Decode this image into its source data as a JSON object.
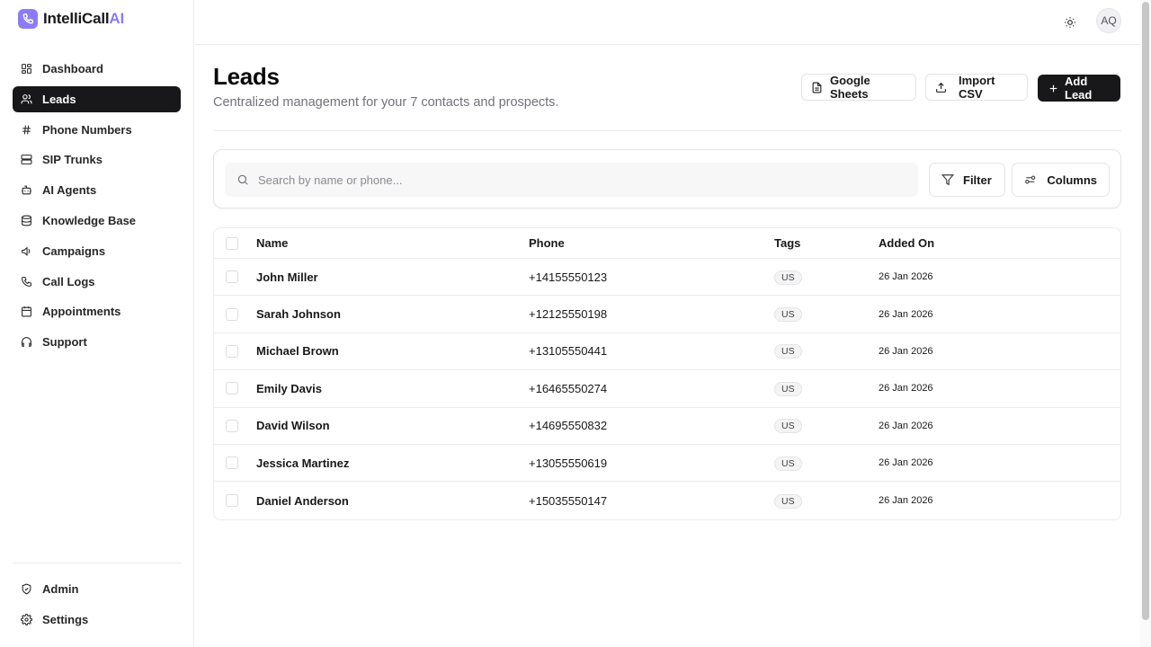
{
  "brand": {
    "name": "IntelliCall",
    "suffix": "AI"
  },
  "sidebar": {
    "items": [
      {
        "label": "Dashboard",
        "icon": "dashboard-icon"
      },
      {
        "label": "Leads",
        "icon": "users-icon",
        "active": true
      },
      {
        "label": "Phone Numbers",
        "icon": "hash-icon"
      },
      {
        "label": "SIP Trunks",
        "icon": "server-icon"
      },
      {
        "label": "AI Agents",
        "icon": "bot-icon"
      },
      {
        "label": "Knowledge Base",
        "icon": "database-icon"
      },
      {
        "label": "Campaigns",
        "icon": "megaphone-icon"
      },
      {
        "label": "Call Logs",
        "icon": "phone-icon"
      },
      {
        "label": "Appointments",
        "icon": "calendar-icon"
      },
      {
        "label": "Support",
        "icon": "headphones-icon"
      }
    ],
    "bottom": [
      {
        "label": "Admin",
        "icon": "shield-icon"
      },
      {
        "label": "Settings",
        "icon": "gear-icon"
      }
    ]
  },
  "topbar": {
    "avatar_initials": "AQ",
    "theme_icon": "sun-icon"
  },
  "page": {
    "title": "Leads",
    "subtitle": "Centralized management for your 7 contacts and prospects."
  },
  "actions": {
    "google_sheets": "Google Sheets",
    "import_csv": "Import CSV",
    "add_lead": "Add Lead"
  },
  "search": {
    "placeholder": "Search by name or phone...",
    "value": "",
    "filter_label": "Filter",
    "columns_label": "Columns"
  },
  "table": {
    "columns": [
      "Name",
      "Phone",
      "Tags",
      "Added On"
    ],
    "rows": [
      {
        "name": "John Miller",
        "phone": "+14155550123",
        "tag": "US",
        "added": "26 Jan 2026"
      },
      {
        "name": "Sarah Johnson",
        "phone": "+12125550198",
        "tag": "US",
        "added": "26 Jan 2026"
      },
      {
        "name": "Michael Brown",
        "phone": "+13105550441",
        "tag": "US",
        "added": "26 Jan 2026"
      },
      {
        "name": "Emily Davis",
        "phone": "+16465550274",
        "tag": "US",
        "added": "26 Jan 2026"
      },
      {
        "name": "David Wilson",
        "phone": "+14695550832",
        "tag": "US",
        "added": "26 Jan 2026"
      },
      {
        "name": "Jessica Martinez",
        "phone": "+13055550619",
        "tag": "US",
        "added": "26 Jan 2026"
      },
      {
        "name": "Daniel Anderson",
        "phone": "+15035550147",
        "tag": "US",
        "added": "26 Jan 2026"
      }
    ]
  },
  "colors": {
    "accent": "#8b7cf6",
    "dark": "#18181b",
    "muted": "#71717a",
    "border": "#ececee"
  }
}
